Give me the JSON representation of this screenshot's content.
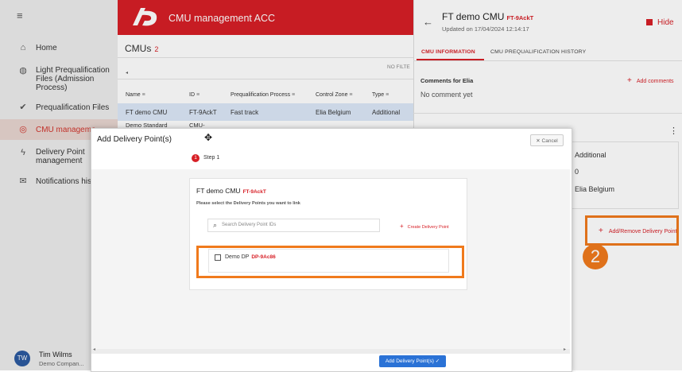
{
  "app": {
    "title": "CMU management ACC"
  },
  "sidebar": {
    "items": [
      {
        "icon": "home-icon",
        "label": "Home"
      },
      {
        "icon": "globe-icon",
        "label": "Light Prequalification Files (Admission Process)"
      },
      {
        "icon": "check-circle-icon",
        "label": "Prequalification Files"
      },
      {
        "icon": "cmu-icon",
        "label": "CMU manageme"
      },
      {
        "icon": "bolt-icon",
        "label": "Delivery Point management"
      },
      {
        "icon": "mail-icon",
        "label": "Notifications hist"
      }
    ],
    "user": {
      "initials": "TW",
      "name": "Tim Wilms",
      "company": "Demo Compan..."
    }
  },
  "list": {
    "title": "CMUs",
    "count": "2",
    "no_filter": "NO FILTE",
    "columns": [
      "Name",
      "ID",
      "Prequalification Process",
      "Control Zone",
      "Type"
    ],
    "rows": [
      [
        "FT demo CMU",
        "FT-9AckT",
        "Fast track",
        "Elia Belgium",
        "Additional"
      ],
      [
        "Demo Standard",
        "CMU-",
        "",
        "",
        ""
      ]
    ]
  },
  "panel": {
    "title": "FT demo CMU",
    "id": "FT-9AckT",
    "updated": "Updated on 17/04/2024 12:14:17",
    "hide_label": "Hide",
    "tabs": [
      "CMU INFORMATION",
      "CMU PREQUALIFICATION HISTORY"
    ],
    "comments_label": "Comments for Elia",
    "add_comments": "Add comments",
    "no_comment": "No comment yet",
    "values": [
      "Additional",
      "0",
      "Elia Belgium"
    ],
    "add_remove_dp": "Add/Remove Delivery Point",
    "badge": "2"
  },
  "modal": {
    "title": "Add Delivery Point(s)",
    "cancel": "Cancel",
    "step_number": "1",
    "step_label": "Step 1",
    "card_title": "FT demo CMU",
    "card_id": "FT-9AckT",
    "instruction": "Please select the Delivery Points you want to link",
    "search_placeholder": "Search Delivery Point IDs",
    "create_dp": "Create Delivery Point",
    "dp_name": "Demo DP",
    "dp_id": "DP-9Ac86",
    "submit": "Add Delivery Point(s)"
  },
  "colors": {
    "brand_red": "#d71f26",
    "highlight_orange": "#f07a1c",
    "primary_blue": "#2a72d6"
  }
}
